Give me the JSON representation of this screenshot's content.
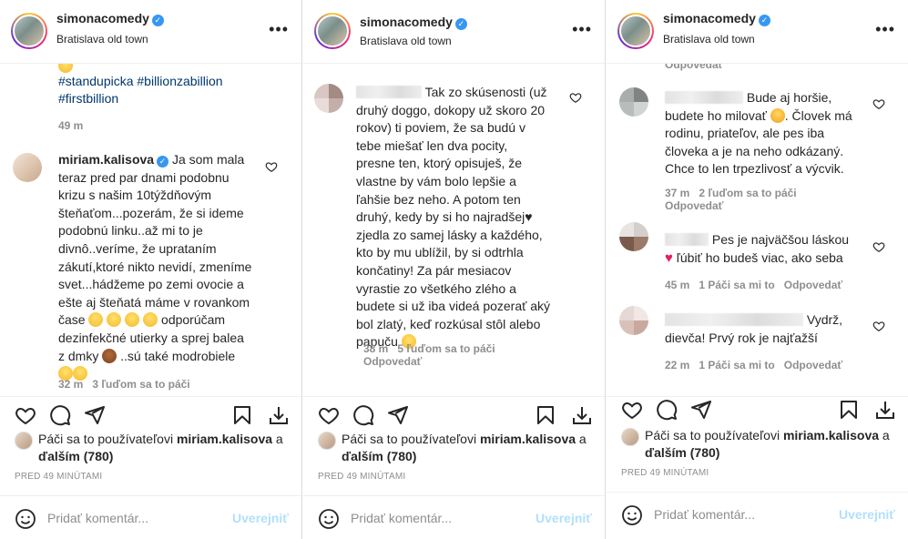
{
  "colors": {
    "link": "#00376b",
    "muted": "#8e8e8e",
    "post_disabled": "#b2dffc",
    "verified": "#3897f0"
  },
  "common": {
    "username": "simonacomedy",
    "location": "Bratislava old town",
    "more": "•••",
    "reply_label": "Odpovedať",
    "likes_line1": "Páči sa to používateľovi",
    "likes_user": "miriam.kalisova",
    "likes_and": "a",
    "likes_others": "ďalším (780)",
    "add_comment_placeholder": "Pridať komentár...",
    "post_label": "Uverejniť"
  },
  "panel1": {
    "caption_hashtags": "#standupicka #billionzabillion #firstbillion",
    "caption_time": "49 m",
    "comment": {
      "user": "miriam.kalisova",
      "text_lines": [
        "Ja som mala",
        "teraz pred par dnami podobnu",
        "krizu s našim 10týždňovým",
        "šteňaťom...pozerám, že si ideme",
        "podobnú linku..až mi to je",
        "divnô..veríme, že uprataním",
        "zákutí,ktoré nikto nevidí, zmeníme",
        "svet...hádžeme po zemi ovocie a",
        "ešte aj šteňatá máme v rovankom",
        "čase",
        "odporúčam",
        "dezinfekčné utierky a sprej balea",
        "z dmky",
        "..sú také modrobiele"
      ],
      "time": "32 m",
      "likes": "3 ľuďom sa to páči"
    },
    "time_ago": "PRED 49 MINÚTAMI"
  },
  "panel2": {
    "comment": {
      "text_lines": [
        "Tak zo skúsenosti (už",
        "druhý doggo, dokopy už skoro 20",
        "rokov) ti poviem, že sa budú v",
        "tebe miešať len dva pocity,",
        "presne ten, ktorý opisuješ, že",
        "vlastne by vám bolo lepšie a",
        "ľahšie bez neho. A potom ten",
        "druhý, kedy by si ho najradšej",
        "zjedla zo samej lásky a každého,",
        "kto by mu ublížil, by si odtrhla",
        "končatiny! Za pár mesiacov",
        "vyrastie zo všetkého zlého a",
        "budete si už iba videá pozerať aký",
        "bol zlatý, keď rozkúsal stôl alebo",
        "papuču"
      ],
      "time": "38 m",
      "likes": "5 ľuďom sa to páči"
    },
    "time_ago": "PRED 49 MINÚTAMI"
  },
  "panel3": {
    "comments": [
      {
        "text_lines": [
          "Bude aj horšie,",
          "budete ho milovať",
          ". Človek má",
          "rodinu, priateľov, ale pes iba",
          "človeka a je na neho odkázaný.",
          "Chce to len trpezlivosť a výcvik."
        ],
        "time": "37 m",
        "likes": "2 ľuďom sa to páči"
      },
      {
        "text_lines": [
          "Pes je najväčšou láskou",
          "ľúbiť ho budeš viac, ako seba"
        ],
        "time": "45 m",
        "likes": "1 Páči sa mi to"
      },
      {
        "text_lines": [
          "Vydrž,",
          "dievča! Prvý rok je najťažší"
        ],
        "time": "22 m",
        "likes": "1 Páči sa mi to"
      }
    ],
    "time_ago": "PRED 49 MINÚTAMI"
  }
}
